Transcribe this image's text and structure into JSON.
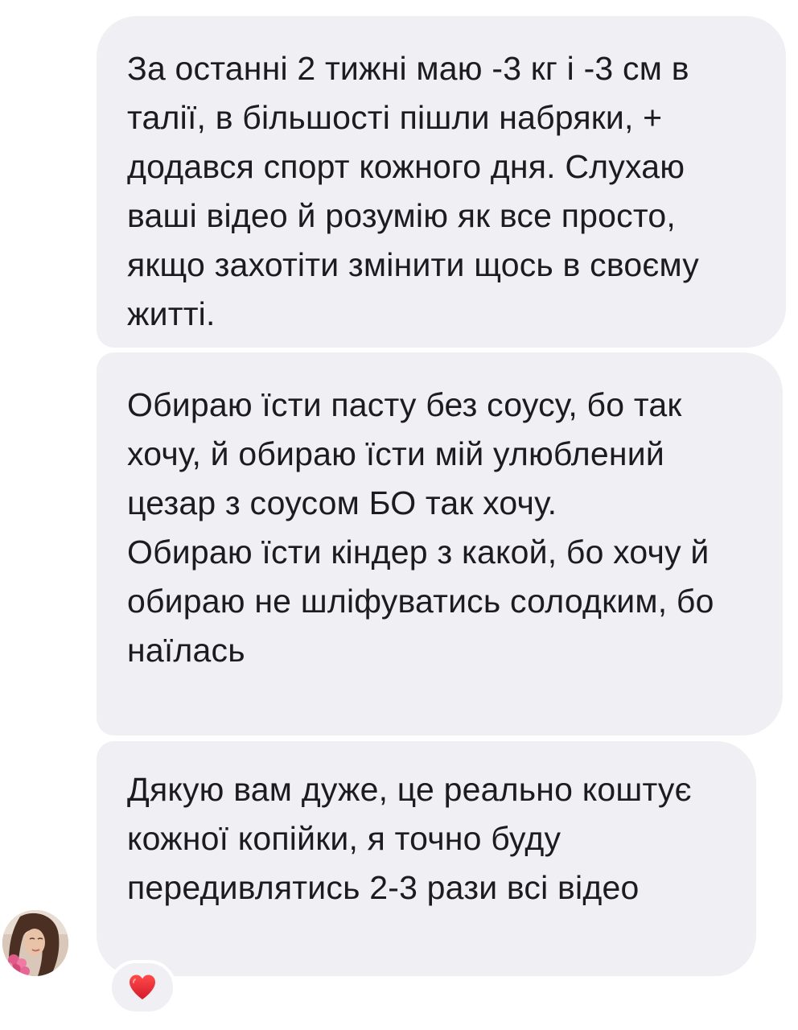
{
  "messages": [
    {
      "paragraphs": [
        "За останні 2 тижні маю -3 кг і -3 см в талії, в більшості пішли набряки, + додався спорт кожного дня. Слухаю ваші відео й розумію як все просто, якщо захотіти змінити щось в своєму житті."
      ]
    },
    {
      "paragraphs": [
        "Обираю їсти пасту без соусу, бо так хочу, й обираю їсти мій улюблений цезар з соусом БО так хочу.",
        "Обираю їсти кіндер з какой, бо хочу й обираю не шліфуватись солодким, бо наїлась"
      ]
    },
    {
      "paragraphs": [
        "Дякую вам дуже, це реально коштує кожної копійки, я точно буду передивлятись 2-3 рази всі відео"
      ]
    }
  ],
  "reaction": {
    "icon": "heart-icon",
    "color": "#e0202e"
  },
  "colors": {
    "bubble_background": "#efeff4",
    "text": "#1c1c1e"
  }
}
